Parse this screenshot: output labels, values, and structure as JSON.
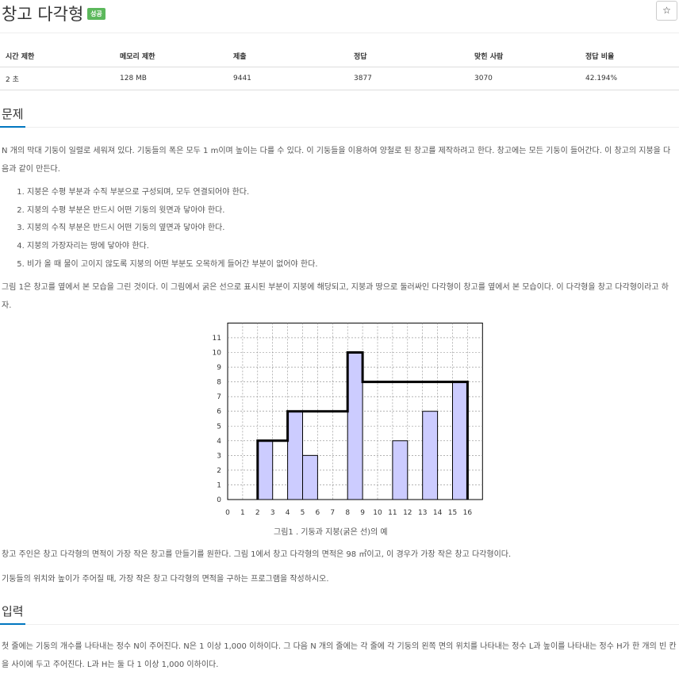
{
  "title": "창고 다각형",
  "badge": "성공",
  "star_glyph": "☆",
  "stats": {
    "headers": [
      "시간 제한",
      "메모리 제한",
      "제출",
      "정답",
      "맞힌 사람",
      "정답 비율"
    ],
    "values": [
      "2 초",
      "128 MB",
      "9441",
      "3877",
      "3070",
      "42.194%"
    ]
  },
  "problem": {
    "heading": "문제",
    "intro": "N 개의 막대 기둥이 일렬로 세워져 있다. 기둥들의 폭은 모두 1 m이며 높이는 다를 수 있다. 이 기둥들을 이용하여 양철로 된 창고를 제작하려고 한다. 창고에는 모든 기둥이 들어간다. 이 창고의 지붕을 다음과 같이 만든다.",
    "rules": [
      "지붕은 수평 부분과 수직 부분으로 구성되며, 모두 연결되어야 한다.",
      "지붕의 수평 부분은 반드시 어떤 기둥의 윗면과 닿아야 한다.",
      "지붕의 수직 부분은 반드시 어떤 기둥의 옆면과 닿아야 한다.",
      "지붕의 가장자리는 땅에 닿아야 한다.",
      "비가 올 때 물이 고이지 않도록 지붕의 어떤 부분도 오목하게 들어간 부분이 없어야 한다."
    ],
    "figure_desc": "그림 1은 창고를 옆에서 본 모습을 그린 것이다. 이 그림에서 굵은 선으로 표시된 부분이 지붕에 해당되고, 지붕과 땅으로 둘러싸인 다각형이 창고를 옆에서 본 모습이다. 이 다각형을 창고 다각형이라고 하자.",
    "figure_caption": "그림1 . 기둥과 지붕(굵은 선)의 예",
    "area_text": "창고 주인은 창고 다각형의 면적이 가장 작은 창고를 만들기를 원한다. 그림 1에서 창고 다각형의 면적은 98 ㎡이고, 이 경우가 가장 작은 창고 다각형이다.",
    "task_text": "기둥들의 위치와 높이가 주어질 때, 가장 작은 창고 다각형의 면적을 구하는 프로그램을 작성하시오."
  },
  "input": {
    "heading": "입력",
    "text": "첫 줄에는 기둥의 개수를 나타내는 정수 N이 주어진다. N은 1 이상 1,000 이하이다. 그 다음 N 개의 줄에는 각 줄에 각 기둥의 왼쪽 면의 위치를 나타내는 정수 L과 높이를 나타내는 정수 H가 한 개의 빈 칸을 사이에 두고 주어진다. L과 H는 둘 다 1 이상 1,000 이하이다."
  },
  "colors": {
    "accent": "#0076c0",
    "badge": "#5cb85c",
    "bar_fill": "#ccccff",
    "roof": "#000000"
  },
  "chart_data": {
    "type": "bar",
    "x_ticks": [
      0,
      1,
      2,
      3,
      4,
      5,
      6,
      7,
      8,
      9,
      10,
      11,
      12,
      13,
      14,
      15,
      16
    ],
    "y_ticks": [
      0,
      1,
      2,
      3,
      4,
      5,
      6,
      7,
      8,
      9,
      10,
      11
    ],
    "xlim": [
      0,
      17
    ],
    "ylim": [
      0,
      12
    ],
    "grid": true,
    "bars": [
      {
        "left": 2,
        "height": 4
      },
      {
        "left": 4,
        "height": 6
      },
      {
        "left": 5,
        "height": 3
      },
      {
        "left": 8,
        "height": 10
      },
      {
        "left": 11,
        "height": 4
      },
      {
        "left": 13,
        "height": 6
      },
      {
        "left": 15,
        "height": 8
      }
    ],
    "roof": [
      [
        2,
        0
      ],
      [
        2,
        4
      ],
      [
        4,
        4
      ],
      [
        4,
        6
      ],
      [
        8,
        6
      ],
      [
        8,
        10
      ],
      [
        9,
        10
      ],
      [
        9,
        8
      ],
      [
        16,
        8
      ],
      [
        16,
        0
      ]
    ]
  }
}
